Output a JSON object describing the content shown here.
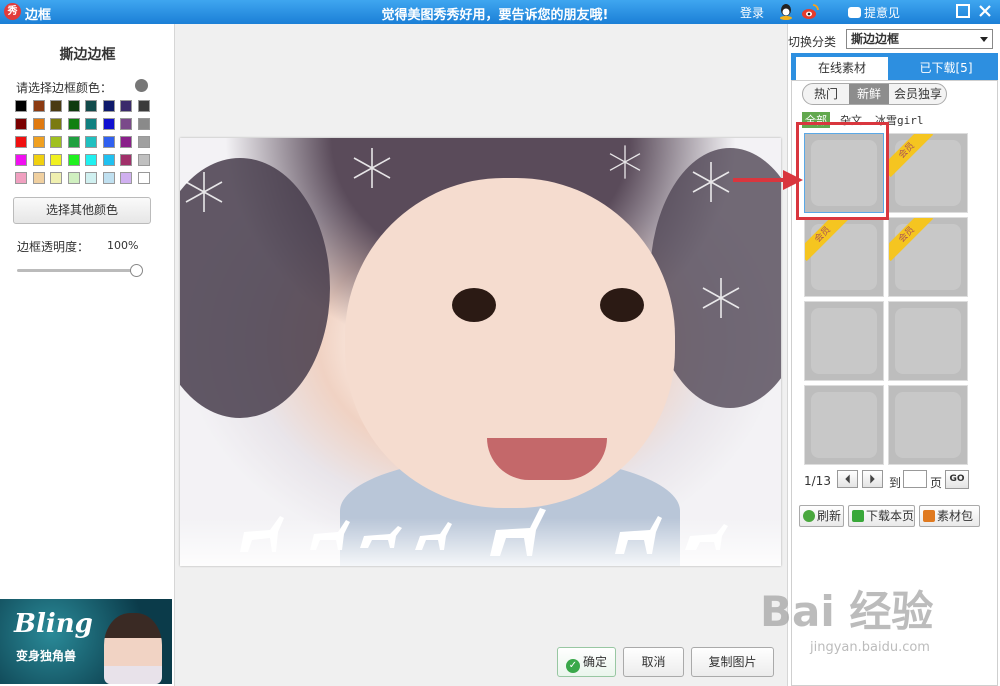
{
  "titlebar": {
    "title": "边框",
    "logo_text": "秀",
    "slogan": "觉得美图秀秀好用，要告诉您的朋友哦!",
    "login": "登录",
    "feedback": "提意见",
    "icons": [
      "qq-icon",
      "weibo-icon",
      "chat-icon",
      "maximize-icon",
      "close-icon"
    ]
  },
  "left_panel": {
    "title": "撕边边框",
    "color_label": "请选择边框颜色：",
    "colors": [
      "#000000",
      "#8b3a12",
      "#4a3a12",
      "#0f3a0f",
      "#124a4a",
      "#0f1a6b",
      "#3a2a6b",
      "#3a3a3a",
      "#7a0000",
      "#e07a10",
      "#7a7a10",
      "#108010",
      "#108080",
      "#1010d0",
      "#7a4a8a",
      "#8a8a8a",
      "#f01010",
      "#f0a020",
      "#a0c020",
      "#20a040",
      "#20c0c0",
      "#3060f0",
      "#8a208a",
      "#a0a0a0",
      "#f010f0",
      "#f0d010",
      "#f0f020",
      "#20f020",
      "#20f0f0",
      "#20c0f0",
      "#a0306a",
      "#c0c0c0",
      "#f0a0c0",
      "#f0d0a0",
      "#f0f0b0",
      "#d0f0c0",
      "#d0f0f0",
      "#c0e0f0",
      "#d0b0f0",
      "#ffffff"
    ],
    "other_color_btn": "选择其他颜色",
    "opacity_label": "边框透明度：",
    "opacity_value": "100%",
    "opacity": 1.0,
    "ad": {
      "brand": "Bling",
      "subtitle": "变身独角兽"
    }
  },
  "actions": {
    "confirm": "确定",
    "cancel": "取消",
    "copy": "复制图片"
  },
  "right_panel": {
    "category_label": "切换分类",
    "category_value": "撕边边框",
    "tabs": [
      {
        "label": "在线素材",
        "active": true
      },
      {
        "label": "已下载[5]",
        "active": false
      }
    ],
    "subtabs": [
      {
        "label": "热门"
      },
      {
        "label": "新鲜",
        "active": true
      },
      {
        "label": "会员独享"
      }
    ],
    "filters": [
      "全部",
      "杂文",
      "冰雪girl"
    ],
    "vip_badge": "会员",
    "pager": {
      "current": "1/13",
      "goto_label": "到",
      "page_label": "页",
      "go": "GO"
    },
    "tools": [
      "刷新",
      "下载本页",
      "素材包"
    ]
  },
  "watermark": {
    "main": "Bai 经验",
    "url": "jingyan.baidu.com"
  }
}
